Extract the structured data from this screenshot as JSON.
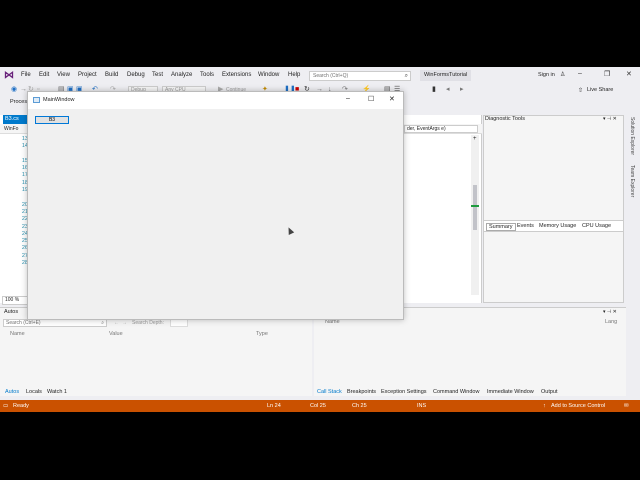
{
  "menu": {
    "items": [
      "File",
      "Edit",
      "View",
      "Project",
      "Build",
      "Debug",
      "Test",
      "Analyze",
      "Tools",
      "Extensions",
      "Window",
      "Help"
    ],
    "search_placeholder": "Search (Ctrl+Q)",
    "solution_name": "WinFormsTutorial",
    "sign_in": "Sign in"
  },
  "toolbar": {
    "config": "Debug",
    "platform": "Any CPU",
    "continue": "Continue",
    "live_share": "Live Share",
    "process_label": "Process"
  },
  "editor": {
    "doc_tab": "B3.cs",
    "nav_left": "WinFo",
    "nav_right": "der, EventArgs e)",
    "line_numbers": [
      "13",
      "14",
      "",
      "15",
      "16",
      "17",
      "18",
      "19",
      "",
      "20",
      "21",
      "22",
      "23",
      "24",
      "25",
      "26",
      "27",
      "28"
    ],
    "zoom": "100 %"
  },
  "diagnostic": {
    "title": "Diagnostic Tools",
    "tabs": [
      "Summary",
      "Events",
      "Memory Usage",
      "CPU Usage"
    ]
  },
  "right_rail": [
    "Solution Explorer",
    "Team Explorer"
  ],
  "autos": {
    "title": "Autos",
    "search_placeholder": "Search (Ctrl+E)",
    "search_depth": "Search Depth:",
    "columns": [
      "Name",
      "Value",
      "Type"
    ],
    "tabs": [
      "Autos",
      "Locals",
      "Watch 1"
    ]
  },
  "callstack": {
    "columns": [
      "Name",
      "Lang"
    ],
    "tabs": [
      "Call Stack",
      "Breakpoints",
      "Exception Settings",
      "Command Window",
      "Immediate Window",
      "Output"
    ]
  },
  "status": {
    "state": "Ready",
    "line": "Ln 24",
    "col": "Col 25",
    "ch": "Ch 25",
    "mode": "INS",
    "source_control": "Add to Source Control"
  },
  "main_window": {
    "title": "MainWindow",
    "button_label": "B3"
  },
  "colors": {
    "status_bar": "#ca5100",
    "accent": "#007acc",
    "vs_purple": "#68217a"
  }
}
